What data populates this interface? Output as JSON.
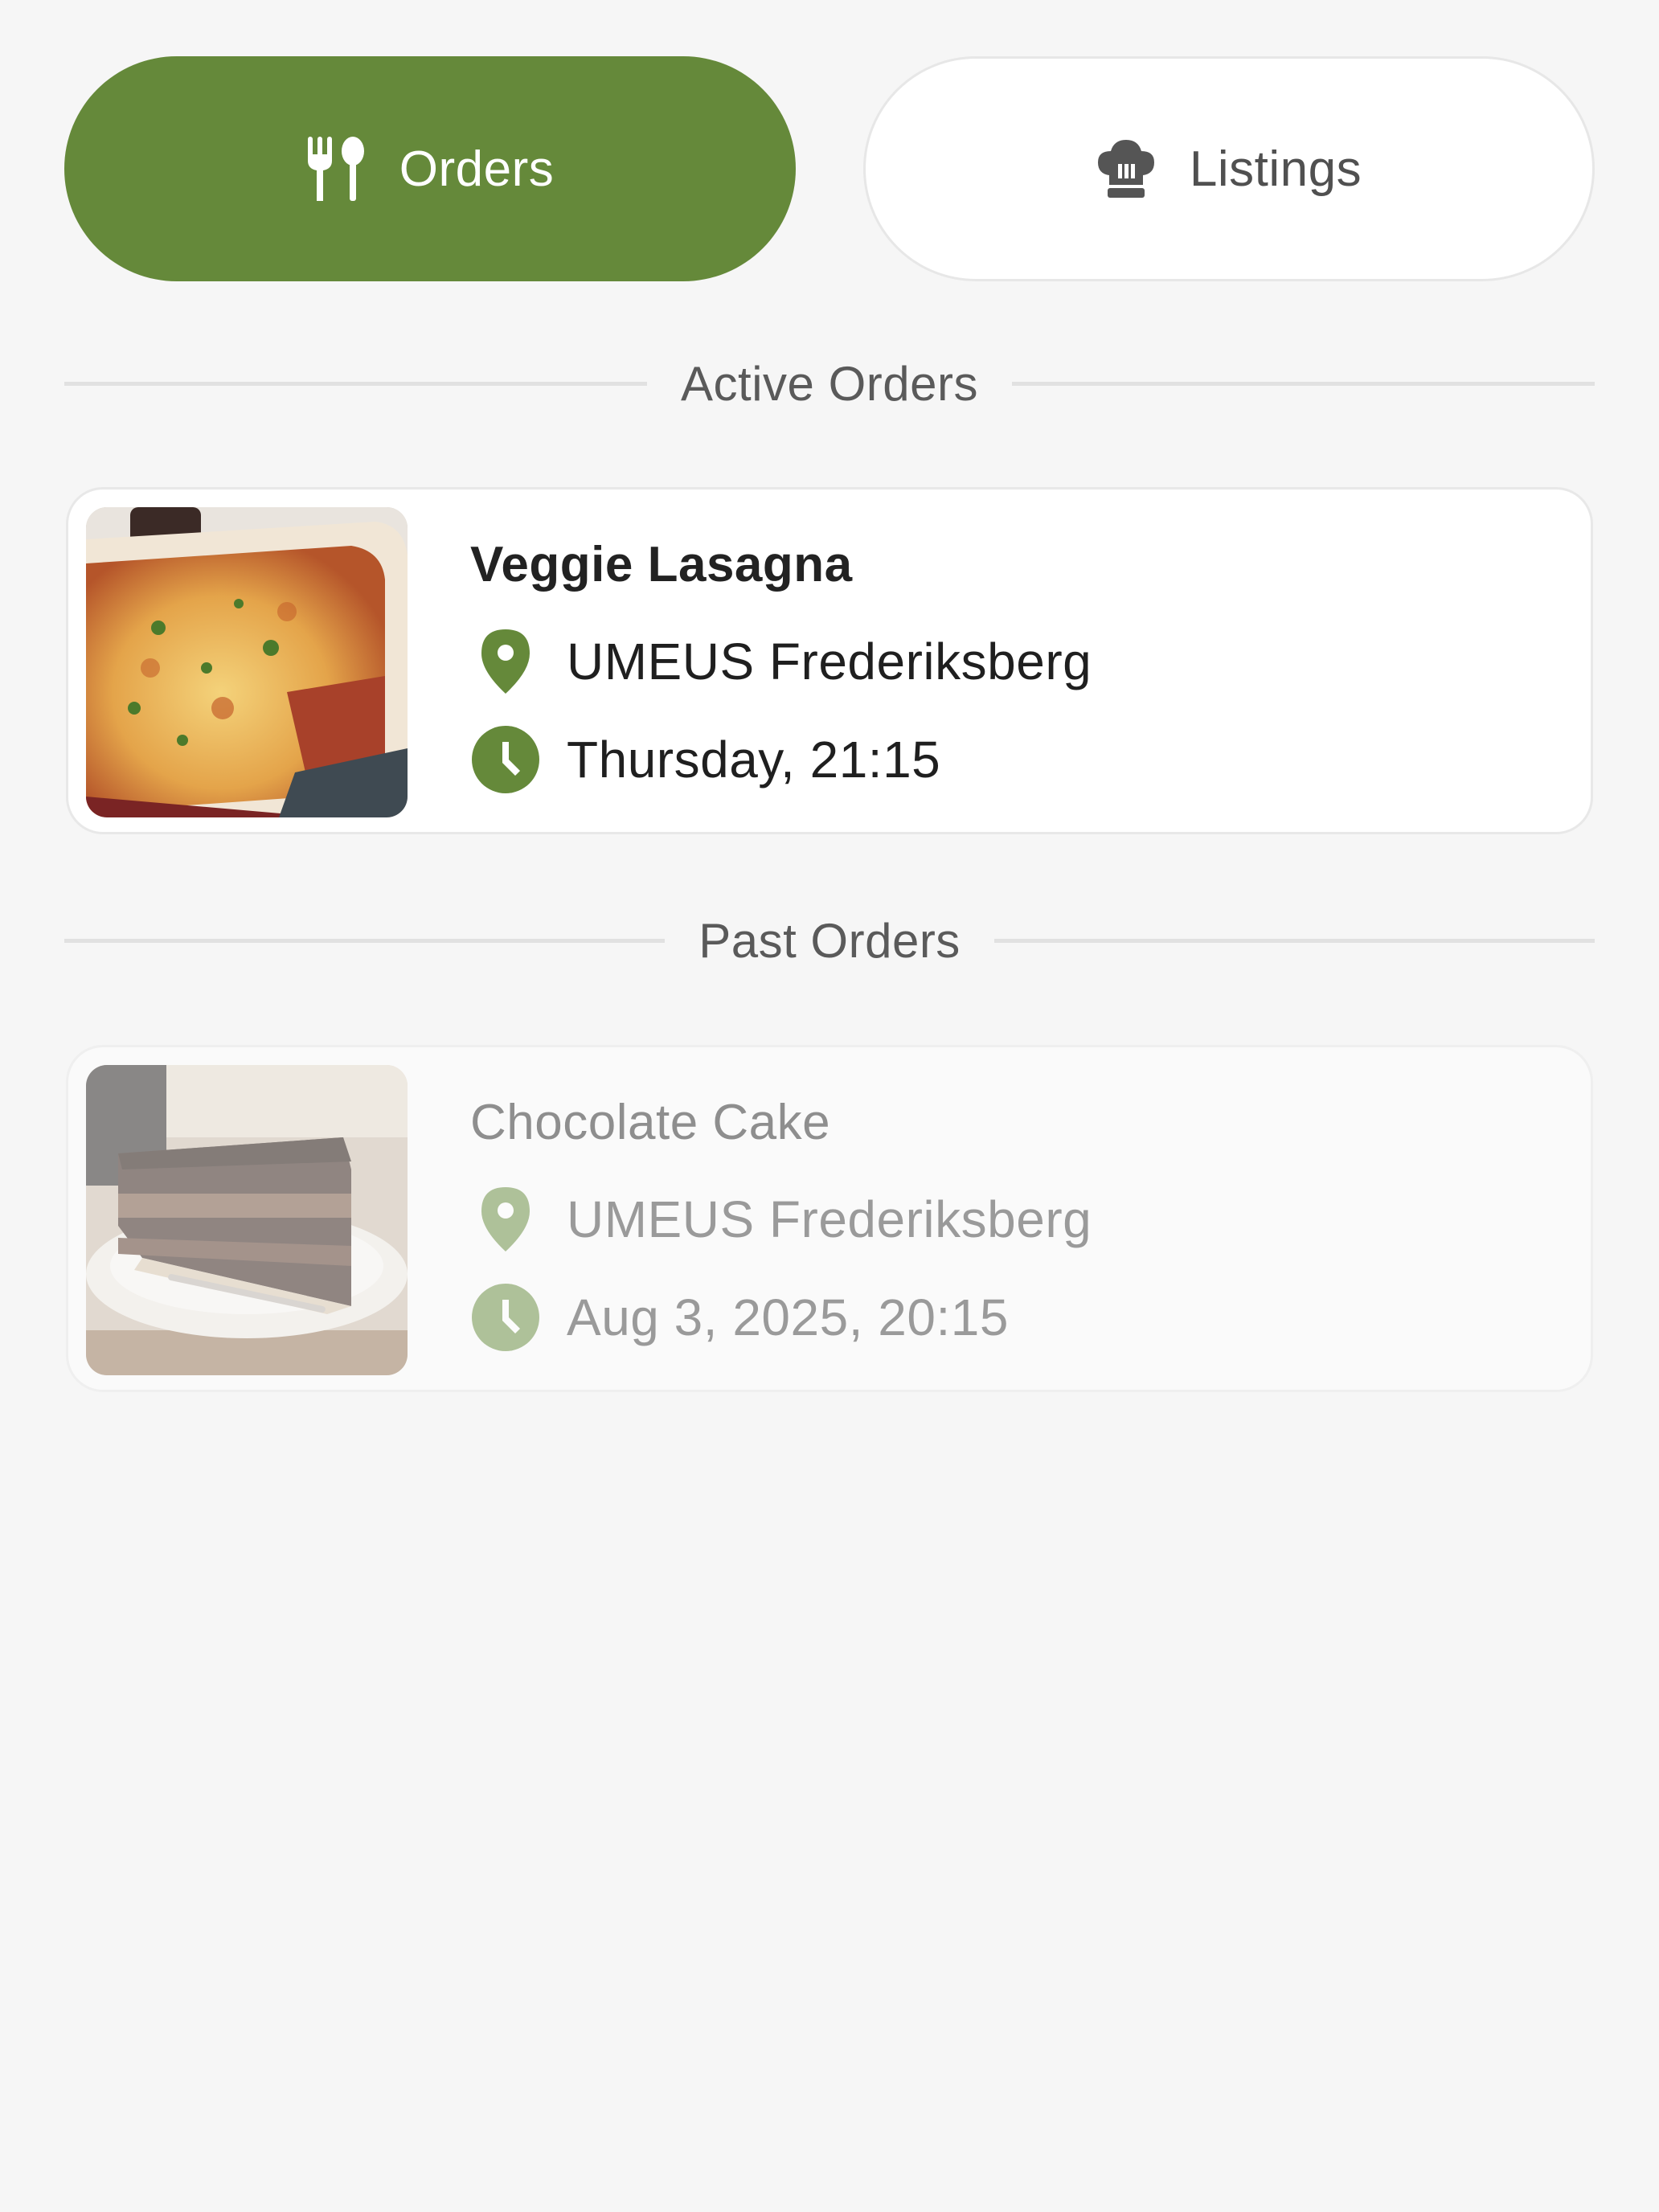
{
  "tabs": {
    "orders": {
      "label": "Orders",
      "icon": "cutlery-icon",
      "active": true
    },
    "listings": {
      "label": "Listings",
      "icon": "chef-hat-icon",
      "active": false
    }
  },
  "sections": {
    "active_title": "Active Orders",
    "past_title": "Past Orders"
  },
  "active_orders": [
    {
      "title": "Veggie Lasagna",
      "location": "UMEUS Frederiksberg",
      "time": "Thursday, 21:15",
      "image": "lasagna-photo"
    }
  ],
  "past_orders": [
    {
      "title": "Chocolate Cake",
      "location": "UMEUS Frederiksberg",
      "time": "Aug 3, 2025, 20:15",
      "image": "chocolate-cake-photo"
    }
  ],
  "colors": {
    "accent": "#65893a",
    "background": "#f6f6f6",
    "card": "#ffffff"
  }
}
